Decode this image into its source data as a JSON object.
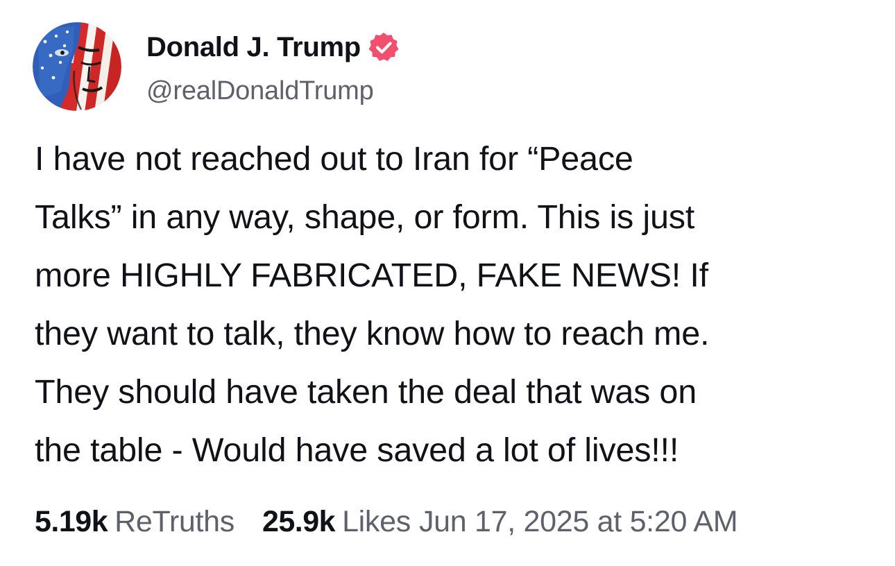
{
  "author": {
    "display_name": "Donald J. Trump",
    "handle": "@realDonaldTrump",
    "verified": true,
    "badge_color": "#f0506e"
  },
  "post": {
    "lines": [
      "I have not reached out to Iran for “Peace",
      "Talks” in any way, shape, or form. This is just",
      "more HIGHLY FABRICATED, FAKE NEWS! If",
      "they want to talk, they know how to reach me.",
      "They should have taken the deal that was on",
      "the table - Would have saved a lot of lives!!!"
    ]
  },
  "stats": {
    "retruths_count": "5.19k",
    "retruths_label": "ReTruths",
    "likes_count": "25.9k",
    "likes_label": "Likes",
    "timestamp": "Jun 17, 2025 at 5:20 AM"
  },
  "colors": {
    "text_primary": "#111118",
    "text_secondary": "#5f606b",
    "background": "#ffffff"
  }
}
